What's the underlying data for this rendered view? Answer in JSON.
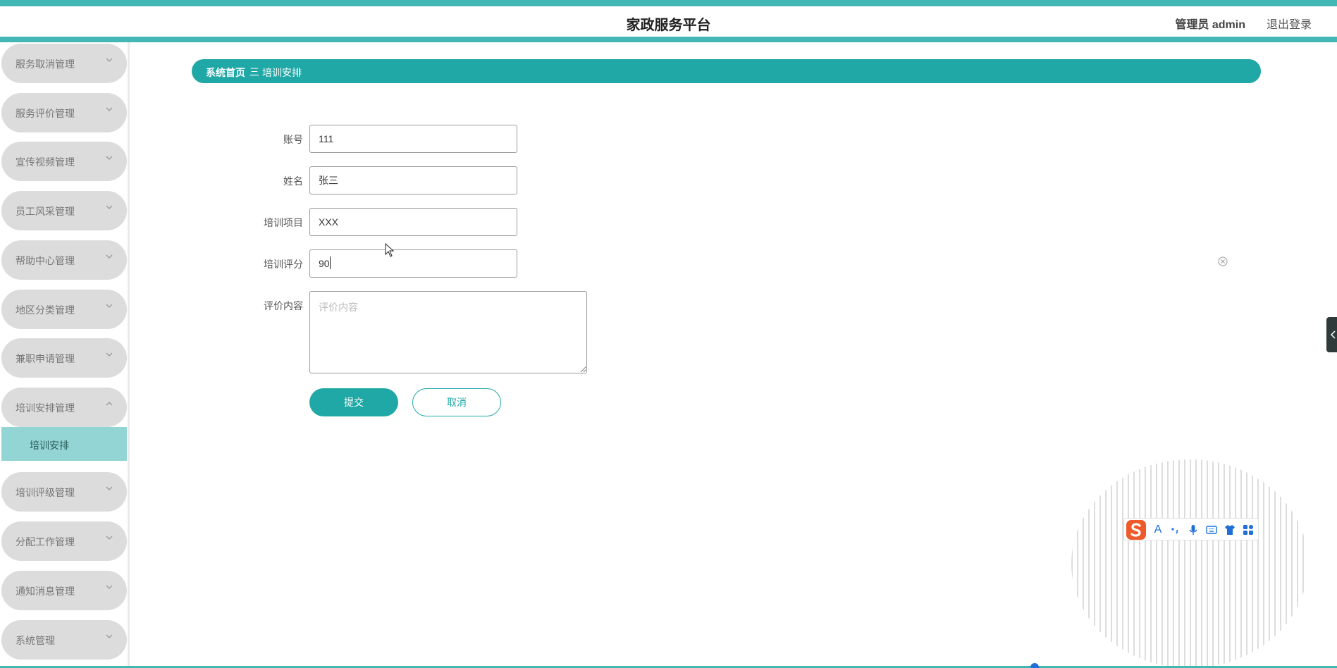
{
  "header": {
    "title": "家政服务平台",
    "admin": "管理员 admin",
    "logout": "退出登录"
  },
  "sidebar": {
    "groups": [
      {
        "label": "服务取消管理",
        "expanded": false
      },
      {
        "label": "服务评价管理",
        "expanded": false
      },
      {
        "label": "宣传视频管理",
        "expanded": false
      },
      {
        "label": "员工风采管理",
        "expanded": false
      },
      {
        "label": "帮助中心管理",
        "expanded": false
      },
      {
        "label": "地区分类管理",
        "expanded": false
      },
      {
        "label": "兼职申请管理",
        "expanded": false
      },
      {
        "label": "培训安排管理",
        "expanded": true
      },
      {
        "label": "培训评级管理",
        "expanded": false
      },
      {
        "label": "分配工作管理",
        "expanded": false
      },
      {
        "label": "通知消息管理",
        "expanded": false
      },
      {
        "label": "系统管理",
        "expanded": false
      }
    ],
    "active_sub": "培训安排"
  },
  "breadcrumb": {
    "home": "系统首页",
    "separator": "三",
    "current": "培训安排"
  },
  "form": {
    "account": {
      "label": "账号",
      "value": "111"
    },
    "name": {
      "label": "姓名",
      "value": "张三"
    },
    "project": {
      "label": "培训项目",
      "value": "XXX"
    },
    "score": {
      "label": "培训评分",
      "value": "90"
    },
    "comment": {
      "label": "评价内容",
      "value": "",
      "placeholder": "评价内容"
    },
    "submit": "提交",
    "cancel": "取消"
  },
  "colors": {
    "accent": "#1fa8a6",
    "header_border": "#43b7b3",
    "menu_bg": "#dcdcdc",
    "active_sub_bg": "#93d5d4"
  }
}
